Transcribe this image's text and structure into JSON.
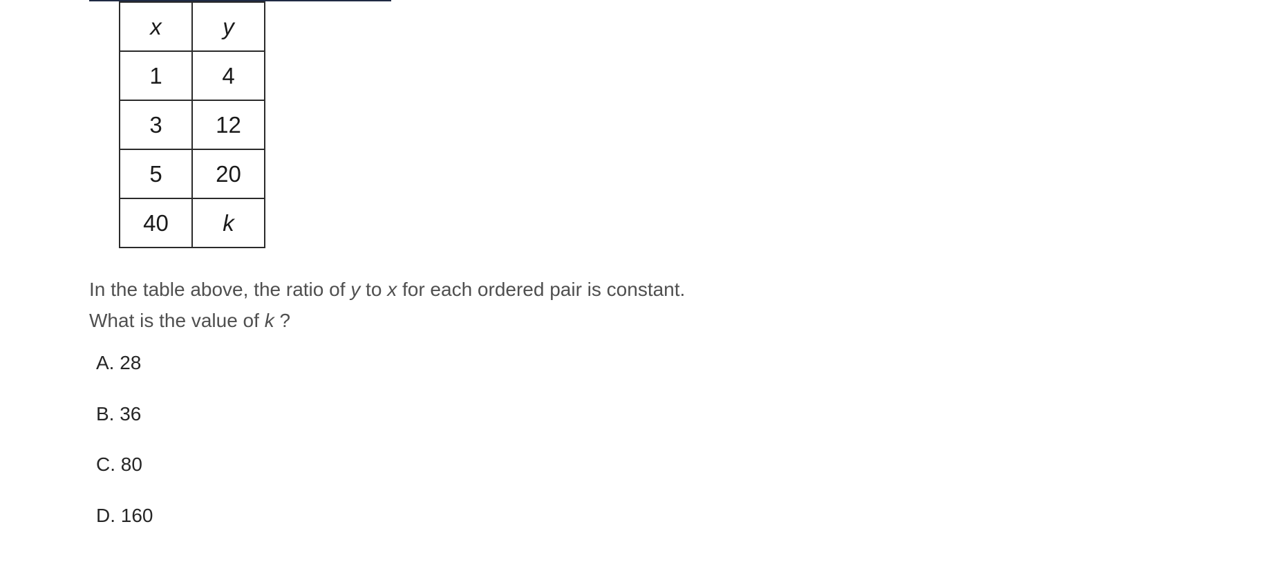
{
  "table": {
    "header": {
      "x": "x",
      "y": "y"
    },
    "rows": [
      {
        "x": "1",
        "y": "4"
      },
      {
        "x": "3",
        "y": "12"
      },
      {
        "x": "5",
        "y": "20"
      },
      {
        "x": "40",
        "y": "k"
      }
    ]
  },
  "question": {
    "part1": "In the table above, the ratio of ",
    "var_y": "y",
    "part2": " to ",
    "var_x": "x",
    "part3": " for each ordered pair is constant. What is the value of ",
    "var_k": "k",
    "part4": " ?"
  },
  "choices": [
    {
      "label": "A. 28"
    },
    {
      "label": "B. 36"
    },
    {
      "label": "C. 80"
    },
    {
      "label": "D. 160"
    }
  ]
}
